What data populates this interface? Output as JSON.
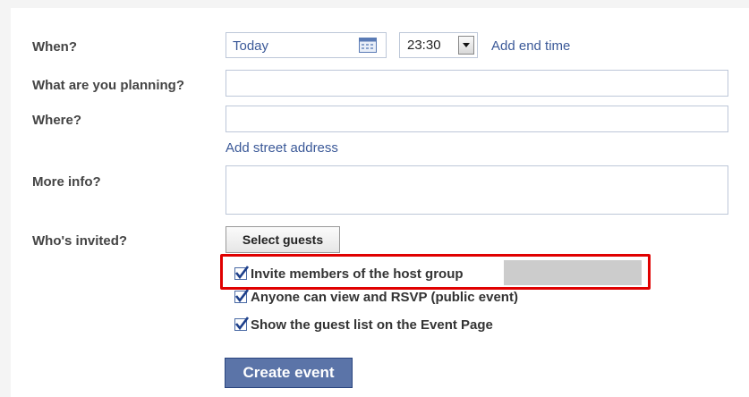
{
  "form": {
    "when_label": "When?",
    "date_value": "Today",
    "time_value": "23:30",
    "add_end_time_link": "Add end time",
    "planning_label": "What are you planning?",
    "planning_value": "",
    "where_label": "Where?",
    "where_value": "",
    "add_street_address_link": "Add street address",
    "more_info_label": "More info?",
    "more_info_value": "",
    "invited_label": "Who's invited?",
    "select_guests_button": "Select guests",
    "options": [
      {
        "label": "Invite members of the host group",
        "checked": true
      },
      {
        "label": "Anyone can view and RSVP (public event)",
        "checked": true
      },
      {
        "label": "Show the guest list on the Event Page",
        "checked": true
      }
    ],
    "create_event_button": "Create event"
  },
  "colors": {
    "link": "#3b5998",
    "primary_button": "#5b74a8",
    "highlight_border": "#e00000"
  }
}
